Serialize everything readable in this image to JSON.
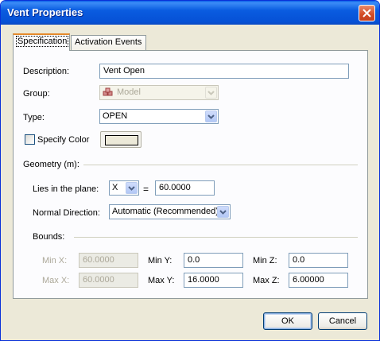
{
  "window": {
    "title": "Vent Properties"
  },
  "tabs": [
    {
      "label": "Specification",
      "active": true
    },
    {
      "label": "Activation Events",
      "active": false
    }
  ],
  "form": {
    "description_label": "Description:",
    "description_value": "Vent Open",
    "group_label": "Group:",
    "group_value": "Model",
    "type_label": "Type:",
    "type_value": "OPEN",
    "specify_color_label": "Specify Color",
    "specify_color_checked": false,
    "color_swatch": "#ece9d8"
  },
  "geometry": {
    "section_label": "Geometry (m):",
    "plane_label": "Lies in the plane:",
    "plane_axis": "X",
    "equals": "=",
    "plane_value": "60.0000",
    "normal_label": "Normal Direction:",
    "normal_value": "Automatic (Recommended)"
  },
  "bounds": {
    "section_label": "Bounds:",
    "min_x_label": "Min X:",
    "min_x": "60.0000",
    "max_x_label": "Max X:",
    "max_x": "60.0000",
    "min_y_label": "Min Y:",
    "min_y": "0.0",
    "max_y_label": "Max Y:",
    "max_y": "16.0000",
    "min_z_label": "Min Z:",
    "min_z": "0.0",
    "max_z_label": "Max Z:",
    "max_z": "6.00000"
  },
  "buttons": {
    "ok": "OK",
    "cancel": "Cancel"
  },
  "colors": {
    "titlebar": "#0a5ce0",
    "panel": "#fcfcfe",
    "dialog": "#ece9d8",
    "disabled_text": "#aca899"
  }
}
